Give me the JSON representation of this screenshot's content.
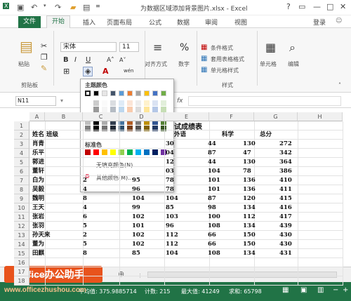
{
  "app": {
    "window_title": "为数据区域添加背景图片.xlsx - Excel",
    "help": "?",
    "login": "登录"
  },
  "tabs": [
    "文件",
    "开始",
    "插入",
    "页面布局",
    "公式",
    "数据",
    "审阅",
    "视图"
  ],
  "ribbon": {
    "paste": "粘贴",
    "clipboard": "剪贴板",
    "font_name": "宋体",
    "font_size": "11",
    "bold": "B",
    "italic": "I",
    "underline": "U",
    "grow": "A˄",
    "shrink": "A˅",
    "wen": "wén",
    "align": "对齐方式",
    "number": "数字",
    "percent": "%",
    "cond_format": "条件格式",
    "table_format": "套用表格格式",
    "cell_style": "单元格样式",
    "styles": "样式",
    "cells": "单元格",
    "edit": "编辑"
  },
  "formula_bar": {
    "namebox": "N11",
    "fx": "fx"
  },
  "columns": [
    "A",
    "B",
    "C",
    "D",
    "E",
    "F",
    "G",
    "H"
  ],
  "rows": [
    "1",
    "2",
    "3",
    "4",
    "5",
    "6",
    "7",
    "8",
    "9",
    "10",
    "11",
    "12",
    "13",
    "14",
    "15",
    "16",
    "17",
    "18"
  ],
  "sheet": {
    "title": "试成绩表",
    "header": [
      "姓名",
      "班级",
      "",
      "",
      "外语",
      "科学",
      "总分"
    ],
    "names": [
      "肖青",
      "乐平",
      "郭进",
      "董轩",
      "白为",
      "吴毅",
      "魏明",
      "王天",
      "张岩",
      "张羽",
      "孙天来",
      "董为",
      "田麒"
    ],
    "class": [
      "",
      "",
      "",
      "",
      "2",
      "4",
      "8",
      "4",
      "6",
      "5",
      "2",
      "5",
      "8"
    ],
    "col_c": [
      "",
      "",
      "",
      "",
      "95",
      "96",
      "104",
      "99",
      "102",
      "101",
      "102",
      "102",
      "85"
    ],
    "col_d": [
      "30",
      "04",
      "12",
      "03",
      "78",
      "78",
      "104",
      "85",
      "103",
      "96",
      "112",
      "112",
      "104"
    ],
    "col_e": [
      "44",
      "87",
      "44",
      "104",
      "101",
      "101",
      "87",
      "98",
      "100",
      "108",
      "66",
      "66",
      "108"
    ],
    "col_f": [
      "130",
      "47",
      "130",
      "78",
      "136",
      "136",
      "120",
      "134",
      "112",
      "134",
      "150",
      "150",
      "134"
    ],
    "col_g": [
      "272",
      "342",
      "364",
      "386",
      "410",
      "411",
      "415",
      "416",
      "417",
      "439",
      "430",
      "430",
      "431"
    ]
  },
  "palette": {
    "theme_label": "主题颜色",
    "standard_label": "标准色",
    "no_fill": "无填充颜色(N)",
    "more_colors": "其他颜色(M)...",
    "theme_colors": [
      "#ffffff",
      "#000000",
      "#e7e6e6",
      "#44546a",
      "#5b9bd5",
      "#ed7d31",
      "#a5a5a5",
      "#ffc000",
      "#4472c4",
      "#70ad47"
    ],
    "standard_colors": [
      "#c00000",
      "#ff0000",
      "#ffc000",
      "#ffff00",
      "#92d050",
      "#00b050",
      "#00b0f0",
      "#0070c0",
      "#002060",
      "#7030a0"
    ]
  },
  "sheetbar": {
    "add": "⊕"
  },
  "status": {
    "avg": "平均值: 375.9885714",
    "count": "计数: 215",
    "max": "最大值: 41249",
    "sum": "求和: 65798",
    "zoom_minus": "−",
    "zoom_plus": "+"
  },
  "branding": {
    "logo": "Office办公助手",
    "url": "www.officezhushou.com"
  }
}
